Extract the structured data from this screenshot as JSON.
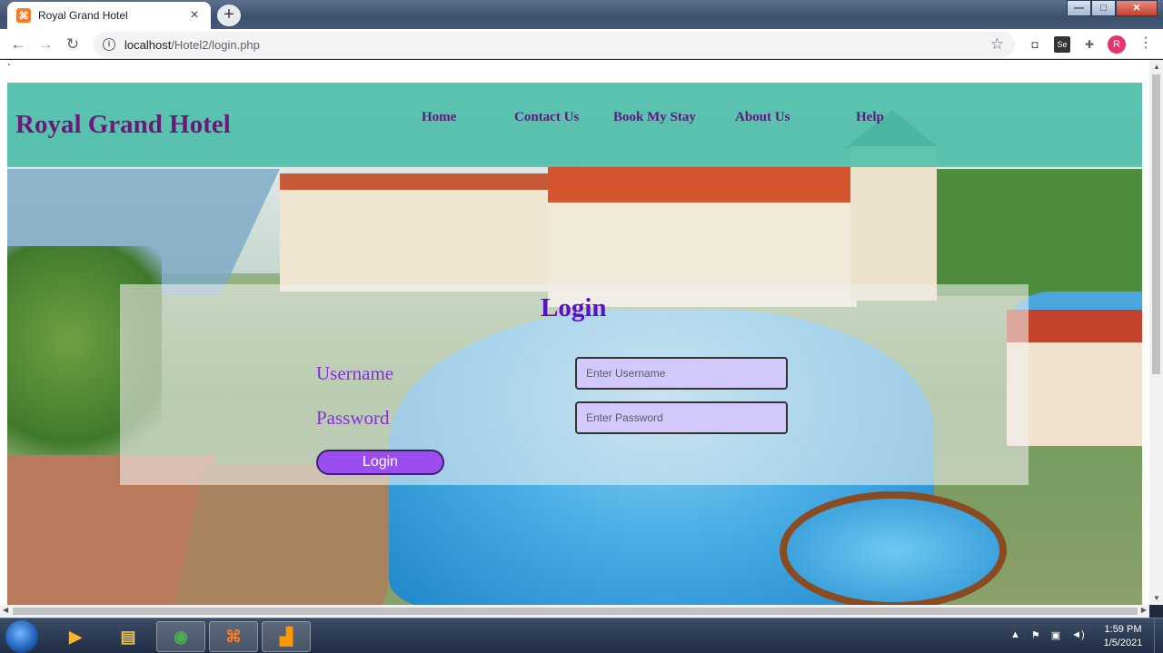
{
  "browser": {
    "tab_title": "Royal Grand Hotel",
    "tab_close": "×",
    "new_tab": "+",
    "url_host": "localhost",
    "url_path": "/Hotel2/login.php",
    "profile_initial": "R",
    "window_buttons": [
      "—",
      "□",
      "✕"
    ]
  },
  "page": {
    "stray_char": "`",
    "site_title": "Royal Grand Hotel",
    "nav": [
      "Home",
      "Contact Us",
      "Book My Stay",
      "About Us",
      "Help"
    ],
    "login": {
      "heading": "Login",
      "username_label": "Username",
      "password_label": "Password",
      "username_placeholder": "Enter Username",
      "password_placeholder": "Enter Password",
      "button": "Login"
    },
    "colors": {
      "header_band": "#48beaa",
      "title": "#6a1b7a",
      "label": "#8a2be2",
      "input_bg": "#d3c8fb",
      "button": "#9c4df0"
    }
  },
  "taskbar": {
    "time": "1:59 PM",
    "date": "1/5/2021"
  }
}
